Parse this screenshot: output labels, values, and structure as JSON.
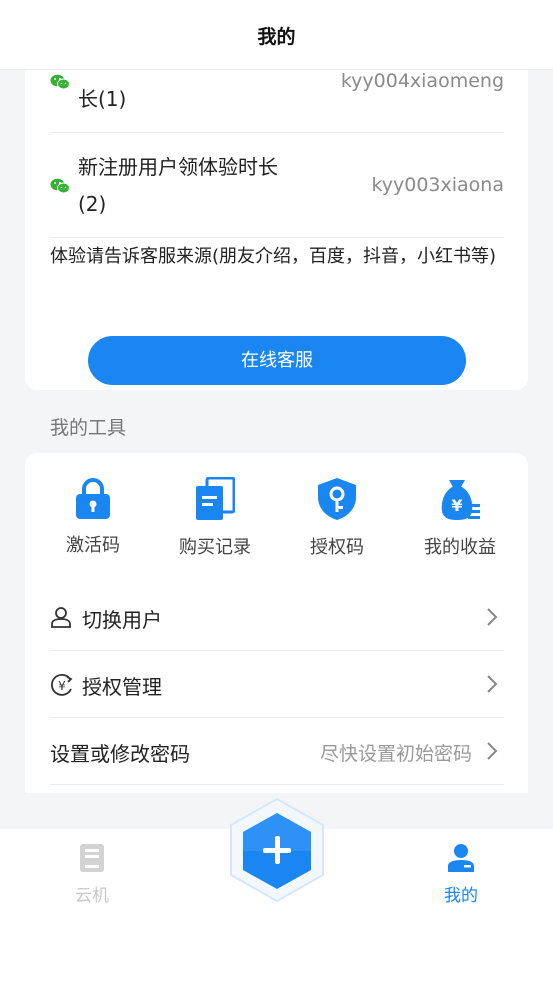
{
  "header": {
    "title": "我的"
  },
  "service": {
    "rows": [
      {
        "name": "长(1)",
        "account": "kyy004xiaomeng"
      },
      {
        "name": "新注册用户领体验时长(2)",
        "account": "kyy003xiaona"
      }
    ],
    "notice": "体验请告诉客服来源(朋友介绍，百度，抖音，小红书等)",
    "online_button": "在线客服"
  },
  "tools": {
    "section_title": "我的工具",
    "items": [
      {
        "label": "激活码",
        "icon": "lock-icon"
      },
      {
        "label": "购买记录",
        "icon": "document-icon"
      },
      {
        "label": "授权码",
        "icon": "key-shield-icon"
      },
      {
        "label": "我的收益",
        "icon": "money-bag-icon"
      }
    ]
  },
  "menu": {
    "switch_user": "切换用户",
    "auth_manage": "授权管理",
    "password": "设置或修改密码",
    "password_hint": "尽快设置初始密码"
  },
  "tabbar": {
    "cloud": "云机",
    "mine": "我的"
  },
  "colors": {
    "primary": "#1a86f2",
    "wechat": "#34b233"
  }
}
